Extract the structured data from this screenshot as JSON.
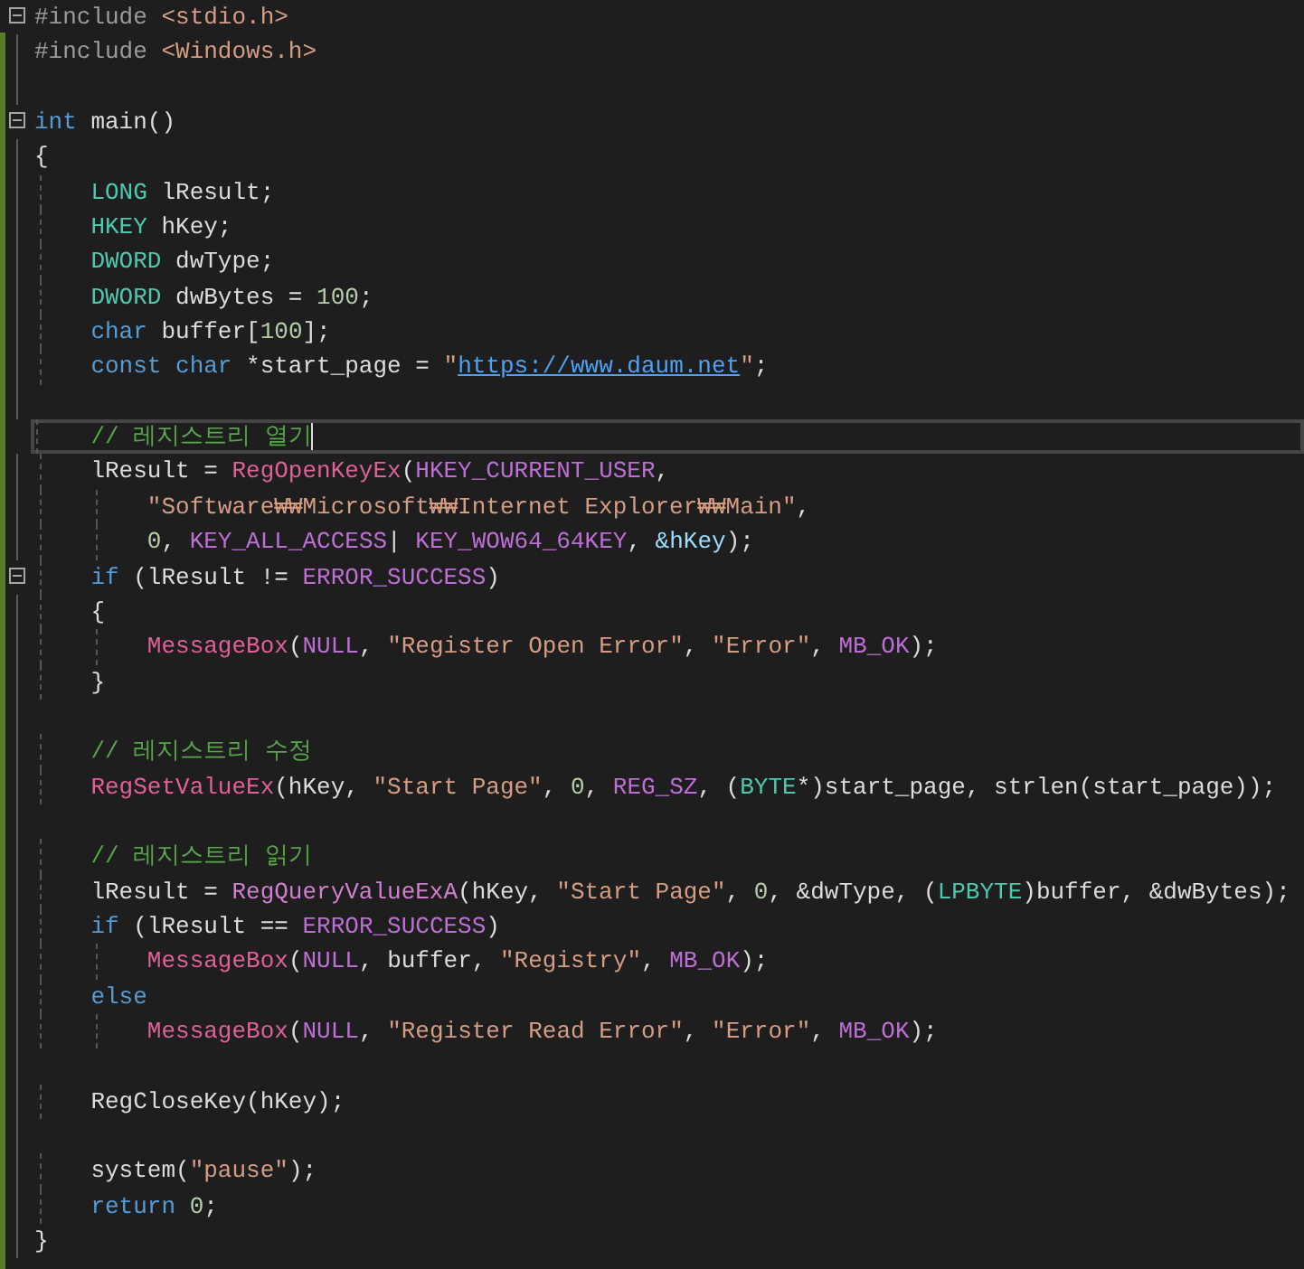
{
  "editor": {
    "lines": [
      {
        "fold": true,
        "current": false,
        "tokens": [
          {
            "text": "#include",
            "kind": "preproc"
          },
          {
            "text": " <stdio.h>",
            "kind": "string"
          }
        ]
      },
      {
        "fold": false,
        "current": false,
        "tokens": [
          {
            "text": "#include",
            "kind": "preproc"
          },
          {
            "text": " <Windows.h>",
            "kind": "string"
          }
        ]
      },
      {
        "fold": false,
        "current": false
      },
      {
        "fold": true,
        "current": false,
        "tokens": [
          {
            "text": "int",
            "kind": "keyword"
          },
          {
            "text": " main()",
            "kind": "plain"
          }
        ]
      },
      {
        "fold": false,
        "current": false,
        "tokens": [
          {
            "text": "{",
            "kind": "plain"
          }
        ]
      },
      {
        "fold": false,
        "current": false,
        "tokens": [
          {
            "text": "    LONG",
            "kind": "type"
          },
          {
            "text": " lResult;",
            "kind": "plain"
          }
        ]
      },
      {
        "fold": false,
        "current": false,
        "tokens": [
          {
            "text": "    HKEY",
            "kind": "type"
          },
          {
            "text": " hKey;",
            "kind": "plain"
          }
        ]
      },
      {
        "fold": false,
        "current": false,
        "tokens": [
          {
            "text": "    DWORD",
            "kind": "type"
          },
          {
            "text": " dwType;",
            "kind": "plain"
          }
        ]
      },
      {
        "fold": false,
        "current": false,
        "tokens": [
          {
            "text": "    DWORD",
            "kind": "type"
          },
          {
            "text": " dwBytes = ",
            "kind": "plain"
          },
          {
            "text": "100",
            "kind": "number"
          },
          {
            "text": ";",
            "kind": "plain"
          }
        ]
      },
      {
        "fold": false,
        "current": false,
        "tokens": [
          {
            "text": "    char",
            "kind": "keyword"
          },
          {
            "text": " buffer[",
            "kind": "plain"
          },
          {
            "text": "100",
            "kind": "number"
          },
          {
            "text": "];",
            "kind": "plain"
          }
        ]
      },
      {
        "fold": false,
        "current": false,
        "tokens": [
          {
            "text": "    const char",
            "kind": "keyword"
          },
          {
            "text": " *start_page = ",
            "kind": "plain"
          },
          {
            "text": "\"",
            "kind": "string"
          },
          {
            "text": "https://www.daum.net",
            "kind": "url"
          },
          {
            "text": "\"",
            "kind": "string"
          },
          {
            "text": ";",
            "kind": "plain"
          }
        ]
      },
      {
        "fold": false,
        "current": false
      },
      {
        "fold": false,
        "current": true,
        "tokens": [
          {
            "text": "    // 레지스트리 열기",
            "kind": "comment"
          }
        ]
      },
      {
        "fold": false,
        "current": false,
        "tokens": [
          {
            "text": "    lResult = ",
            "kind": "plain"
          },
          {
            "text": "RegOpenKeyEx",
            "kind": "macro_func"
          },
          {
            "text": "(",
            "kind": "plain"
          },
          {
            "text": "HKEY_CURRENT_USER",
            "kind": "macro"
          },
          {
            "text": ",",
            "kind": "plain"
          }
        ]
      },
      {
        "fold": false,
        "current": false,
        "tokens": [
          {
            "text": "        \"Software₩₩Microsoft₩₩Internet Explorer₩₩Main\"",
            "kind": "string"
          },
          {
            "text": ",",
            "kind": "plain"
          }
        ]
      },
      {
        "fold": false,
        "current": false,
        "tokens": [
          {
            "text": "        0",
            "kind": "number"
          },
          {
            "text": ", ",
            "kind": "plain"
          },
          {
            "text": "KEY_ALL_ACCESS",
            "kind": "macro"
          },
          {
            "text": "| ",
            "kind": "plain"
          },
          {
            "text": "KEY_WOW64_64KEY",
            "kind": "macro"
          },
          {
            "text": ", ",
            "kind": "plain"
          },
          {
            "text": "&hKey",
            "kind": "param"
          },
          {
            "text": ");",
            "kind": "plain"
          }
        ]
      },
      {
        "fold": true,
        "current": false,
        "tokens": [
          {
            "text": "    if",
            "kind": "keyword"
          },
          {
            "text": " (lResult != ",
            "kind": "plain"
          },
          {
            "text": "ERROR_SUCCESS",
            "kind": "macro"
          },
          {
            "text": ")",
            "kind": "plain"
          }
        ]
      },
      {
        "fold": false,
        "current": false,
        "tokens": [
          {
            "text": "    {",
            "kind": "plain"
          }
        ]
      },
      {
        "fold": false,
        "current": false,
        "tokens": [
          {
            "text": "        MessageBox",
            "kind": "macro_func"
          },
          {
            "text": "(",
            "kind": "plain"
          },
          {
            "text": "NULL",
            "kind": "macro"
          },
          {
            "text": ", ",
            "kind": "plain"
          },
          {
            "text": "\"Register Open Error\"",
            "kind": "string"
          },
          {
            "text": ", ",
            "kind": "plain"
          },
          {
            "text": "\"Error\"",
            "kind": "string"
          },
          {
            "text": ", ",
            "kind": "plain"
          },
          {
            "text": "MB_OK",
            "kind": "macro"
          },
          {
            "text": ");",
            "kind": "plain"
          }
        ]
      },
      {
        "fold": false,
        "current": false,
        "tokens": [
          {
            "text": "    }",
            "kind": "plain"
          }
        ]
      },
      {
        "fold": false,
        "current": false
      },
      {
        "fold": false,
        "current": false,
        "tokens": [
          {
            "text": "    // 레지스트리 수정",
            "kind": "comment"
          }
        ]
      },
      {
        "fold": false,
        "current": false,
        "tokens": [
          {
            "text": "    RegSetValueEx",
            "kind": "macro_func"
          },
          {
            "text": "(hKey, ",
            "kind": "plain"
          },
          {
            "text": "\"Start Page\"",
            "kind": "string"
          },
          {
            "text": ", ",
            "kind": "plain"
          },
          {
            "text": "0",
            "kind": "number"
          },
          {
            "text": ", ",
            "kind": "plain"
          },
          {
            "text": "REG_SZ",
            "kind": "macro"
          },
          {
            "text": ", (",
            "kind": "plain"
          },
          {
            "text": "BYTE",
            "kind": "type"
          },
          {
            "text": "*)start_page, strlen(start_page));",
            "kind": "plain"
          }
        ]
      },
      {
        "fold": false,
        "current": false
      },
      {
        "fold": false,
        "current": false,
        "tokens": [
          {
            "text": "    // 레지스트리 읽기",
            "kind": "comment"
          }
        ]
      },
      {
        "fold": false,
        "current": false,
        "tokens": [
          {
            "text": "    lResult = ",
            "kind": "plain"
          },
          {
            "text": "RegQueryValueExA",
            "kind": "func"
          },
          {
            "text": "(hKey, ",
            "kind": "plain"
          },
          {
            "text": "\"Start Page\"",
            "kind": "string"
          },
          {
            "text": ", ",
            "kind": "plain"
          },
          {
            "text": "0",
            "kind": "number"
          },
          {
            "text": ", &dwType, (",
            "kind": "plain"
          },
          {
            "text": "LPBYTE",
            "kind": "type"
          },
          {
            "text": ")buffer, &dwBytes);",
            "kind": "plain"
          }
        ]
      },
      {
        "fold": false,
        "current": false,
        "tokens": [
          {
            "text": "    if",
            "kind": "keyword"
          },
          {
            "text": " (lResult == ",
            "kind": "plain"
          },
          {
            "text": "ERROR_SUCCESS",
            "kind": "macro"
          },
          {
            "text": ")",
            "kind": "plain"
          }
        ]
      },
      {
        "fold": false,
        "current": false,
        "tokens": [
          {
            "text": "        MessageBox",
            "kind": "macro_func"
          },
          {
            "text": "(",
            "kind": "plain"
          },
          {
            "text": "NULL",
            "kind": "macro"
          },
          {
            "text": ", buffer, ",
            "kind": "plain"
          },
          {
            "text": "\"Registry\"",
            "kind": "string"
          },
          {
            "text": ", ",
            "kind": "plain"
          },
          {
            "text": "MB_OK",
            "kind": "macro"
          },
          {
            "text": ");",
            "kind": "plain"
          }
        ]
      },
      {
        "fold": false,
        "current": false,
        "tokens": [
          {
            "text": "    else",
            "kind": "keyword"
          }
        ]
      },
      {
        "fold": false,
        "current": false,
        "tokens": [
          {
            "text": "        MessageBox",
            "kind": "macro_func"
          },
          {
            "text": "(",
            "kind": "plain"
          },
          {
            "text": "NULL",
            "kind": "macro"
          },
          {
            "text": ", ",
            "kind": "plain"
          },
          {
            "text": "\"Register Read Error\"",
            "kind": "string"
          },
          {
            "text": ", ",
            "kind": "plain"
          },
          {
            "text": "\"Error\"",
            "kind": "string"
          },
          {
            "text": ", ",
            "kind": "plain"
          },
          {
            "text": "MB_OK",
            "kind": "macro"
          },
          {
            "text": ");",
            "kind": "plain"
          }
        ]
      },
      {
        "fold": false,
        "current": false
      },
      {
        "fold": false,
        "current": false,
        "tokens": [
          {
            "text": "    RegCloseKey(hKey);",
            "kind": "plain"
          }
        ]
      },
      {
        "fold": false,
        "current": false
      },
      {
        "fold": false,
        "current": false,
        "tokens": [
          {
            "text": "    system(",
            "kind": "plain"
          },
          {
            "text": "\"pause\"",
            "kind": "string"
          },
          {
            "text": ");",
            "kind": "plain"
          }
        ]
      },
      {
        "fold": false,
        "current": false,
        "tokens": [
          {
            "text": "    return",
            "kind": "keyword"
          },
          {
            "text": " 0",
            "kind": "number"
          },
          {
            "text": ";",
            "kind": "plain"
          }
        ]
      },
      {
        "fold": false,
        "current": false,
        "tokens": [
          {
            "text": "}",
            "kind": "plain"
          }
        ]
      }
    ]
  }
}
